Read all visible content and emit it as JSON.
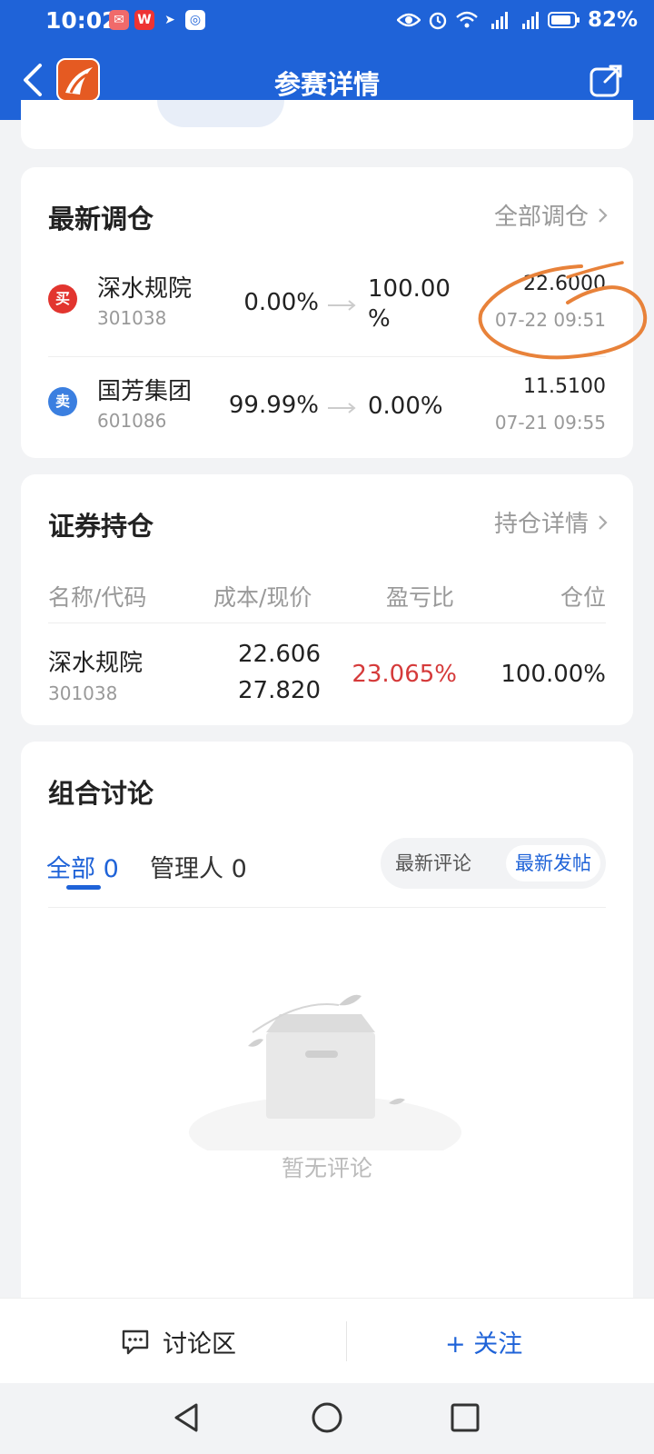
{
  "status_bar": {
    "time": "10:02",
    "battery": "82%"
  },
  "nav": {
    "title": "参赛详情"
  },
  "latest_trades": {
    "title": "最新调仓",
    "link": "全部调仓",
    "items": [
      {
        "action": "买",
        "action_color": "#e2352f",
        "name": "深水规院",
        "code": "301038",
        "from": "0.00%",
        "to_line1": "100.00",
        "to_line2": "%",
        "price": "22.6000",
        "time": "07-22 09:51"
      },
      {
        "action": "卖",
        "action_color": "#3b7fe0",
        "name": "国芳集团",
        "code": "601086",
        "from": "99.99%",
        "to_line1": "0.00%",
        "to_line2": "",
        "price": "11.5100",
        "time": "07-21 09:55"
      }
    ]
  },
  "holdings": {
    "title": "证券持仓",
    "link": "持仓详情",
    "headers": [
      "名称/代码",
      "成本/现价",
      "盈亏比",
      "仓位"
    ],
    "rows": [
      {
        "name": "深水规院",
        "code": "301038",
        "cost": "22.606",
        "price": "27.820",
        "pnl": "23.065%",
        "position": "100.00%"
      }
    ]
  },
  "discussion": {
    "title": "组合讨论",
    "tabs": [
      {
        "label": "全部 0"
      },
      {
        "label": "管理人 0"
      }
    ],
    "sort_options": [
      "最新评论",
      "最新发帖"
    ],
    "empty_text": "暂无评论"
  },
  "bottom_bar": {
    "discuss_label": "讨论区",
    "follow_label": "+ 关注"
  },
  "colors": {
    "brand_blue": "#1f63d8",
    "buy_red": "#e2352f",
    "sell_blue": "#3b7fe0",
    "gain_red": "#d53a3a",
    "annotation_orange": "#e8823a"
  }
}
